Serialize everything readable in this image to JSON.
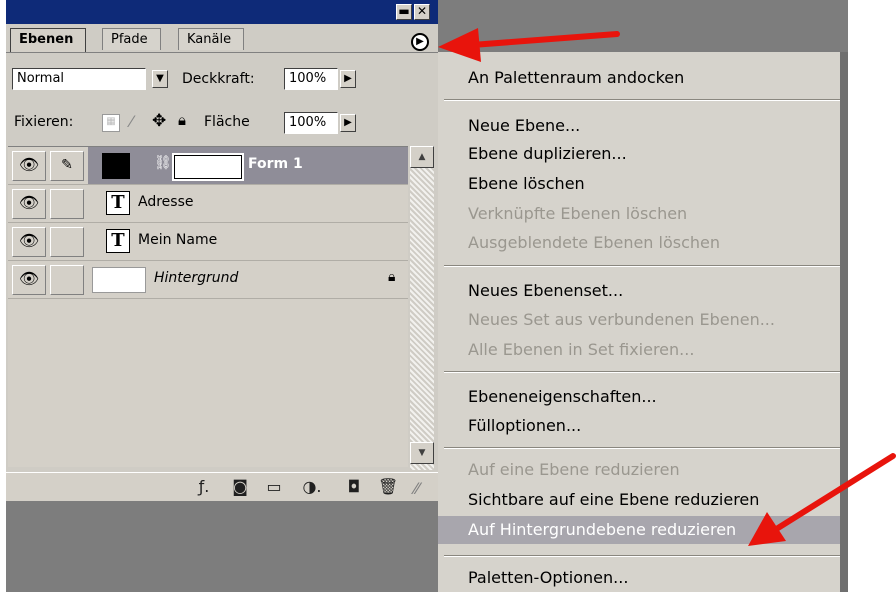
{
  "palette": {
    "tabs": [
      "Ebenen",
      "Pfade",
      "Kanäle"
    ],
    "blend_mode": "Normal",
    "opacity_label": "Deckkraft:",
    "opacity_value": "100%",
    "lock_label": "Fixieren:",
    "fill_label": "Fläche",
    "fill_value": "100%",
    "layers": [
      {
        "name": "Form 1"
      },
      {
        "name": "Adresse",
        "icon": "T"
      },
      {
        "name": "Mein Name",
        "icon": "T"
      },
      {
        "name": "Hintergrund"
      }
    ]
  },
  "menu": {
    "items": [
      {
        "label": "An Palettenraum andocken"
      },
      {
        "label": "Neue Ebene..."
      },
      {
        "label": "Ebene duplizieren..."
      },
      {
        "label": "Ebene löschen"
      },
      {
        "label": "Verknüpfte Ebenen löschen"
      },
      {
        "label": "Ausgeblendete Ebenen löschen"
      },
      {
        "label": "Neues Ebenenset..."
      },
      {
        "label": "Neues Set aus verbundenen Ebenen..."
      },
      {
        "label": "Alle Ebenen in Set fixieren..."
      },
      {
        "label": "Ebeneneigenschaften..."
      },
      {
        "label": "Fülloptionen..."
      },
      {
        "label": "Auf eine Ebene reduzieren"
      },
      {
        "label": "Sichtbare auf eine Ebene reduzieren"
      },
      {
        "label": "Auf Hintergrundebene reduzieren"
      },
      {
        "label": "Paletten-Optionen..."
      }
    ]
  },
  "colors": {
    "titlebar": "#0e2a78",
    "annotation_arrow": "#e8140c",
    "highlight": "#a8a6ad"
  },
  "icons": [
    "eye-icon",
    "brush-icon",
    "link-icon",
    "lock-icon",
    "move-icon",
    "menu-arrow-icon",
    "trash-icon",
    "new-layer-icon",
    "folder-icon",
    "mask-icon",
    "adjustment-icon",
    "style-icon"
  ]
}
